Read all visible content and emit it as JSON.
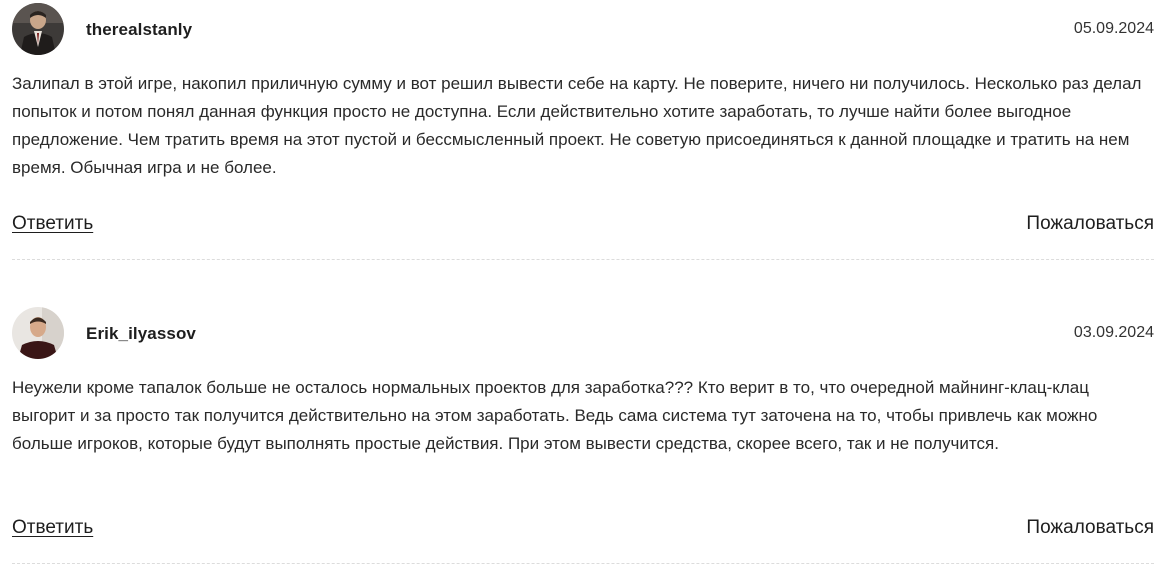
{
  "comments": [
    {
      "username": "therealstanly",
      "date": "05.09.2024",
      "avatar_icon": "user-photo-suit",
      "text": "Залипал в этой игре, накопил приличную сумму и вот решил вывести себе на карту. Не поверите, ничего ни получилось. Несколько раз делал попыток и потом понял данная функция просто не доступна. Если действительно хотите заработать, то лучше найти более выгодное предложение. Чем тратить время на этот пустой и бессмысленный проект. Не советую присоединяться к данной площадке и тратить на нем время. Обычная игра и не более.",
      "reply_label": "Ответить",
      "report_label": "Пожаловаться"
    },
    {
      "username": "Erik_ilyassov",
      "date": "03.09.2024",
      "avatar_icon": "user-photo-casual",
      "text": "Неужели кроме тапалок больше не осталось нормальных проектов для заработка??? Кто верит в то, что очередной майнинг-клац-клац выгорит и за просто так получится действительно на этом заработать. Ведь сама система тут заточена на то, чтобы привлечь как можно больше игроков, которые будут выполнять простые действия. При этом вывести средства, скорее всего, так и не получится.",
      "reply_label": "Ответить",
      "report_label": "Пожаловаться"
    }
  ]
}
